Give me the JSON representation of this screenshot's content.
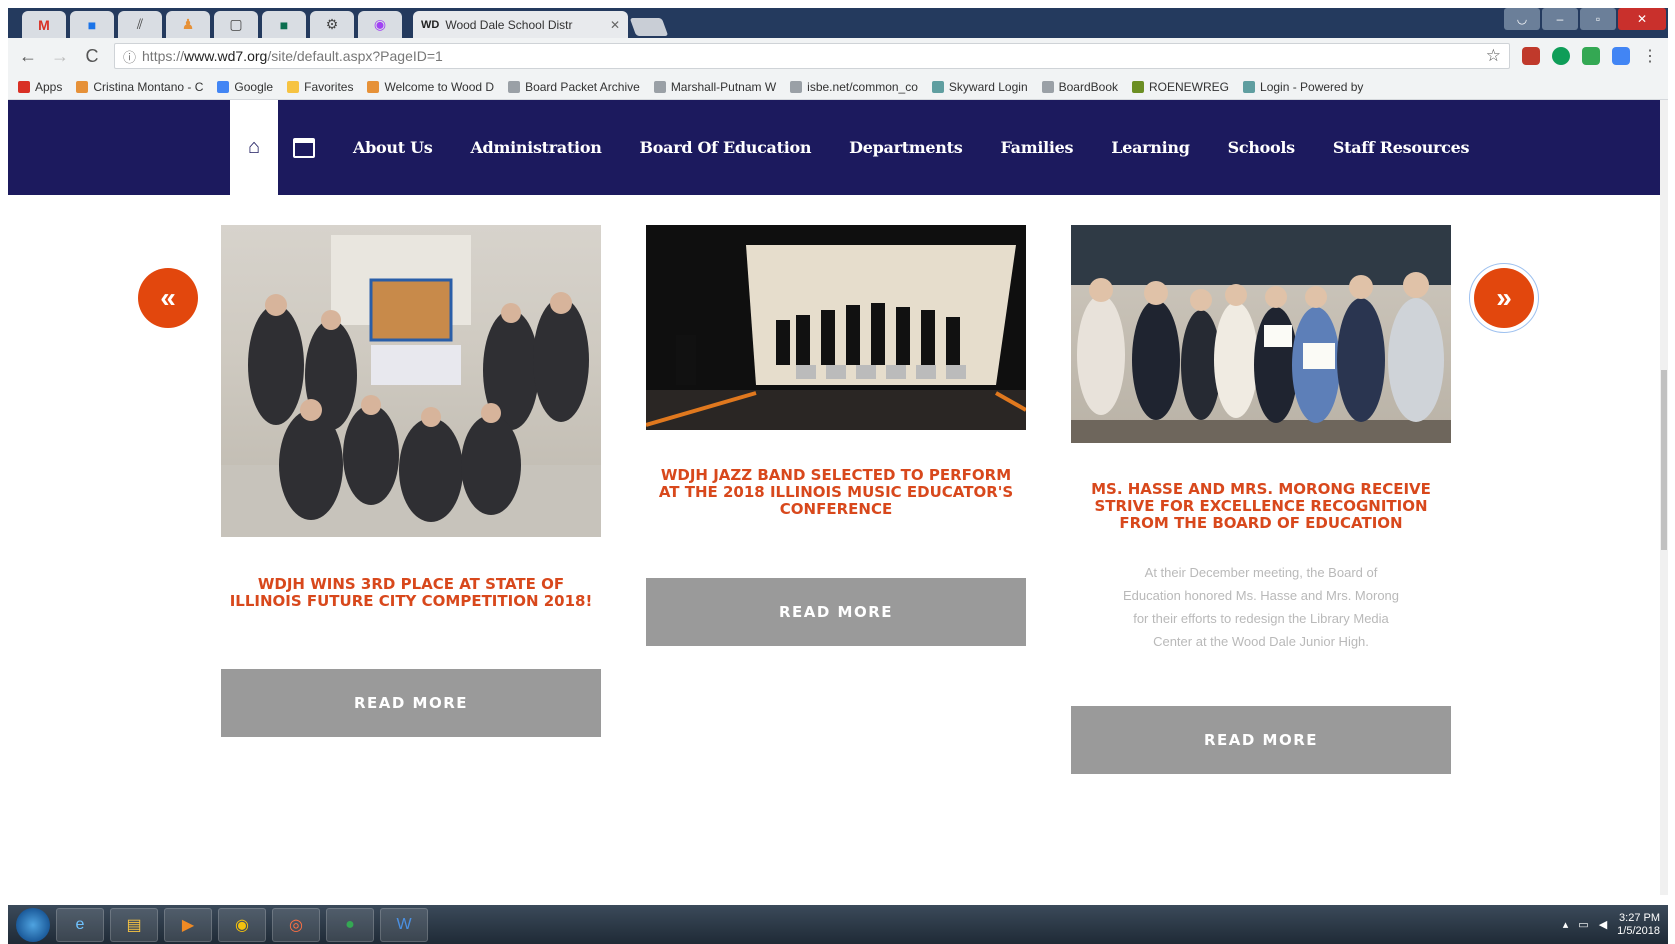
{
  "browser": {
    "active_tab_title": "Wood Dale School Distr",
    "tab_favicon_text": "WD",
    "url_host": "www.wd7.org",
    "url_path": "/site/default.aspx?PageID=1",
    "url_scheme": "https://",
    "bookmarks": [
      {
        "label": "Apps",
        "color": "#d93025"
      },
      {
        "label": "Cristina Montano - C",
        "color": "#e69138"
      },
      {
        "label": "Google",
        "color": "#4285f4"
      },
      {
        "label": "Favorites",
        "color": "#f6c342"
      },
      {
        "label": "Welcome to Wood D",
        "color": "#e69138"
      },
      {
        "label": "Board Packet Archive",
        "color": "#9aa0a6"
      },
      {
        "label": "Marshall-Putnam W",
        "color": "#9aa0a6"
      },
      {
        "label": "isbe.net/common_co",
        "color": "#9aa0a6"
      },
      {
        "label": "Skyward Login",
        "color": "#5f9ea0"
      },
      {
        "label": "BoardBook",
        "color": "#9aa0a6"
      },
      {
        "label": "ROENEWREG",
        "color": "#6b8e23"
      },
      {
        "label": "Login - Powered by",
        "color": "#5f9ea0"
      }
    ]
  },
  "nav": {
    "items": [
      "About Us",
      "Administration",
      "Board Of Education",
      "Departments",
      "Families",
      "Learning",
      "Schools",
      "Staff Resources"
    ]
  },
  "carousel": {
    "prev_symbol": "«",
    "next_symbol": "»",
    "cards": [
      {
        "headline": "WDJH WINS 3RD PLACE AT STATE OF ILLINOIS FUTURE CITY COMPETITION 2018!",
        "description": "",
        "button": "READ MORE"
      },
      {
        "headline": "WDJH JAZZ BAND SELECTED TO PERFORM AT THE 2018 ILLINOIS MUSIC EDUCATOR'S CONFERENCE",
        "description": "",
        "button": "READ MORE"
      },
      {
        "headline": "MS. HASSE AND MRS. MORONG RECEIVE STRIVE FOR EXCELLENCE RECOGNITION FROM THE BOARD OF EDUCATION",
        "description": "At their December meeting, the Board of Education honored Ms. Hasse and Mrs. Morong for their efforts to redesign the Library Media Center at the Wood Dale Junior High.",
        "button": "READ MORE"
      }
    ]
  },
  "taskbar": {
    "time": "3:27 PM",
    "date": "1/5/2018"
  },
  "colors": {
    "nav_bg": "#1c1a5e",
    "accent": "#e2470d",
    "button_gray": "#9a9a9a"
  }
}
